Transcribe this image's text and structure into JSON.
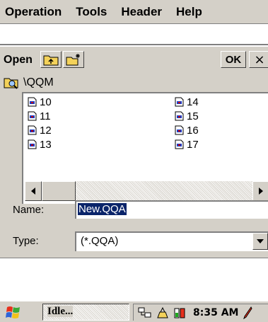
{
  "menubar": {
    "items": [
      "Operation",
      "Tools",
      "Header",
      "Help"
    ]
  },
  "dialog": {
    "title_label": "Open",
    "ok_label": "OK",
    "close_label": "×",
    "path": "\\QQM",
    "files_col1": [
      "10",
      "11",
      "12",
      "13"
    ],
    "files_col2": [
      "14",
      "15",
      "16",
      "17"
    ],
    "name_label": "Name:",
    "name_value": "New.QQA",
    "type_label": "Type:",
    "type_value": "(*.QQA)"
  },
  "taskbar": {
    "idle_label": "Idle...",
    "clock": "8:35 AM"
  }
}
